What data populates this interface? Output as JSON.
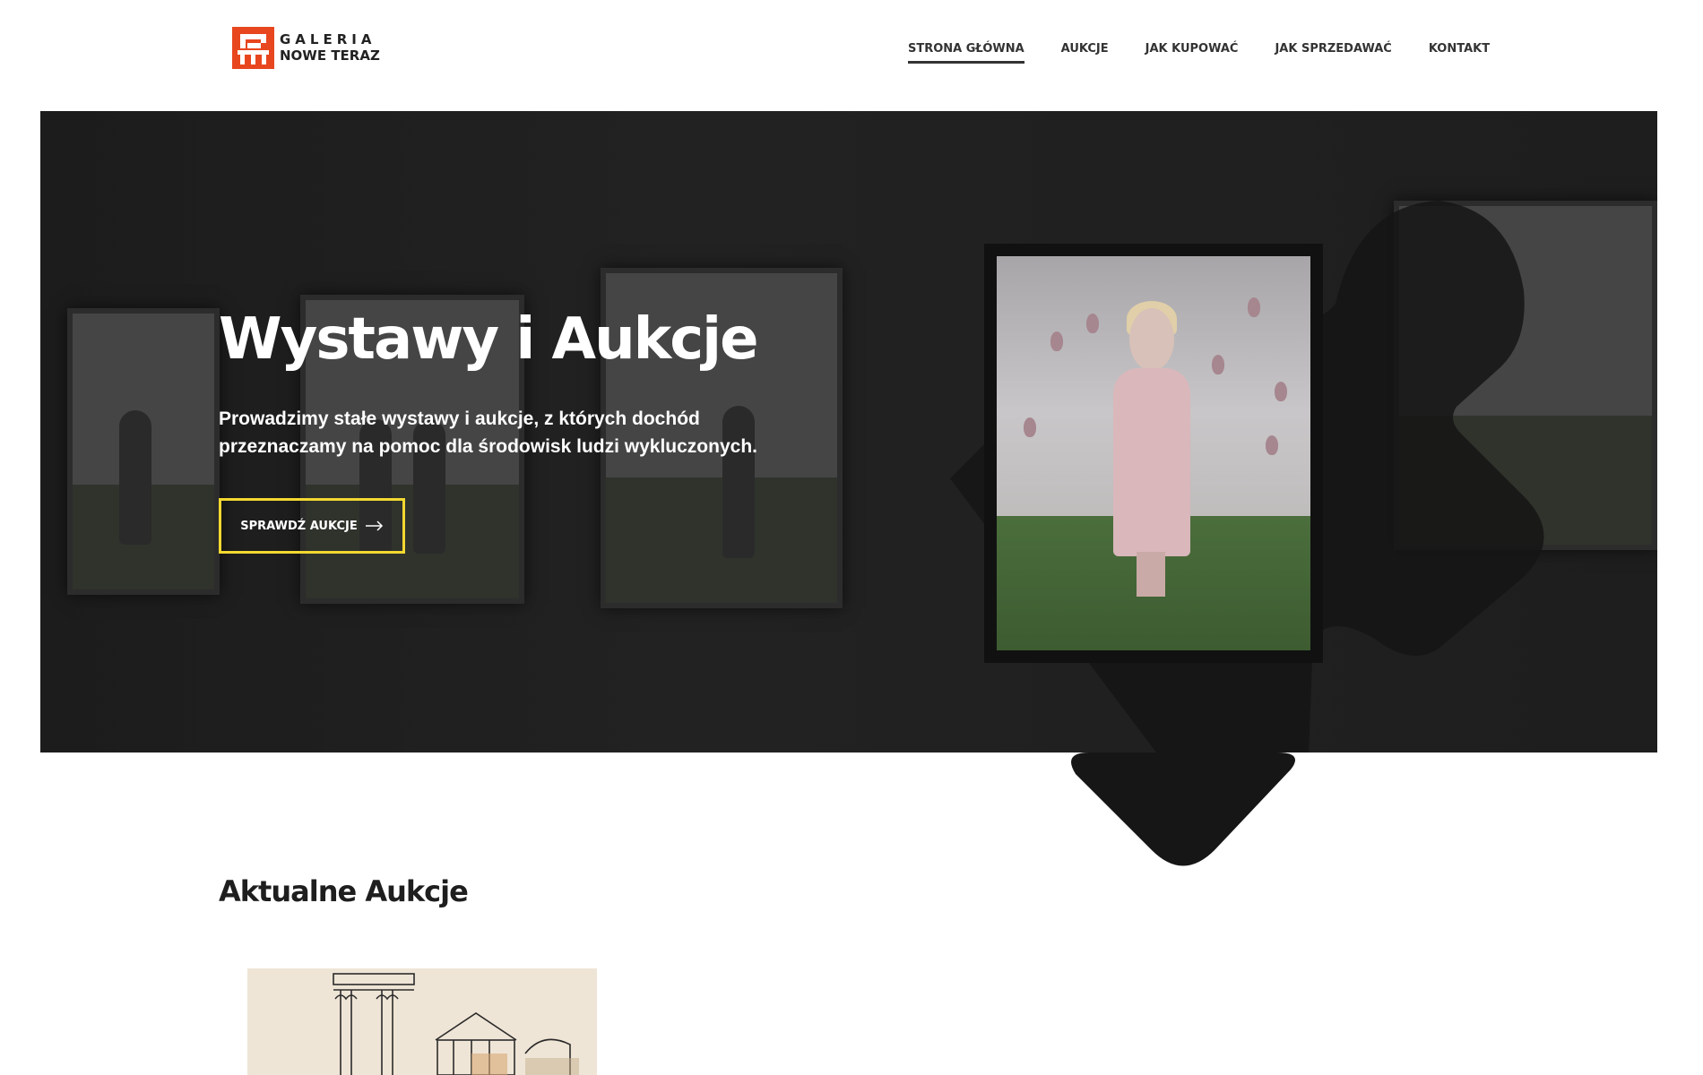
{
  "header": {
    "logo": {
      "line1": "GALERIA",
      "line2": "NOWE TERAZ",
      "accent_color": "#e8461e"
    },
    "nav": [
      {
        "label": "STRONA GŁÓWNA",
        "active": true
      },
      {
        "label": "AUKCJE",
        "active": false
      },
      {
        "label": "JAK KUPOWAĆ",
        "active": false
      },
      {
        "label": "JAK SPRZEDAWAĆ",
        "active": false
      },
      {
        "label": "KONTAKT",
        "active": false
      }
    ]
  },
  "hero": {
    "title": "Wystawy i Aukcje",
    "subtitle": "Prowadzimy stałe wystawy i aukcje, z których dochód przeznaczamy na pomoc dla środowisk ludzi wykluczonych.",
    "cta_label": "SPRAWDŹ AUKCJE",
    "cta_icon": "arrow-right-icon",
    "cta_border_color": "#f3d830",
    "background_color": "#1f1f1f"
  },
  "auctions": {
    "title": "Aktualne Aukcje"
  }
}
